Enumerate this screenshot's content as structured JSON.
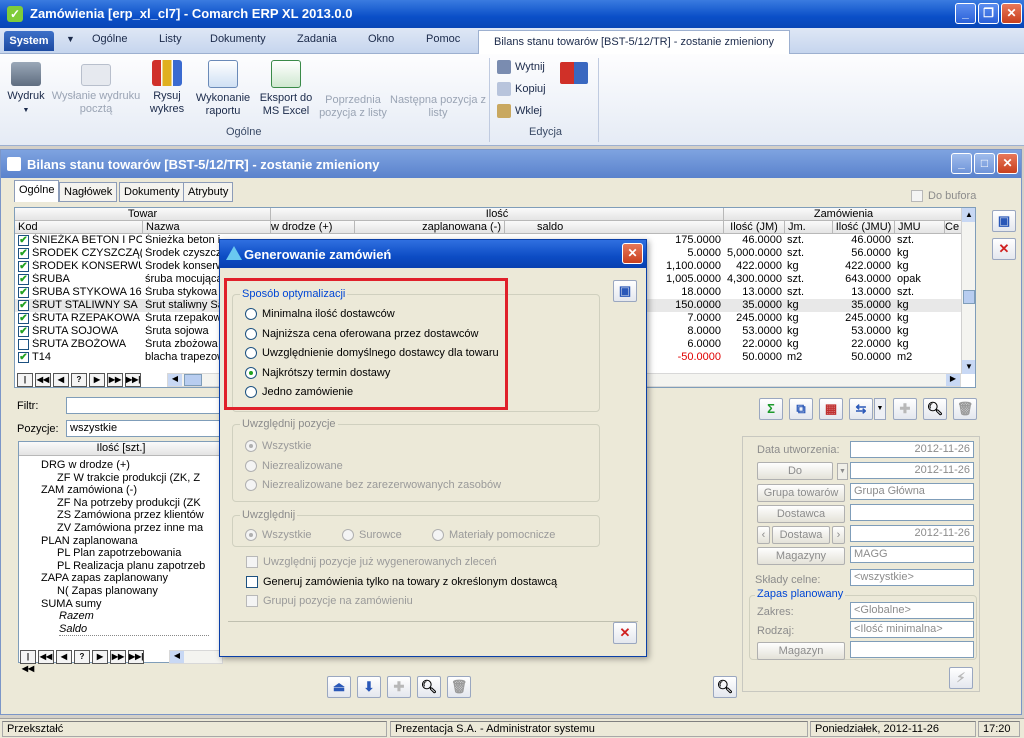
{
  "window": {
    "title": "Zamówienia [erp_xl_cl7] - Comarch ERP XL 2013.0.0"
  },
  "menu": {
    "system": "System",
    "items": [
      "Ogólne",
      "Listy",
      "Dokumenty",
      "Zadania",
      "Okno",
      "Pomoc"
    ],
    "active_tab": "Bilans stanu towarów [BST-5/12/TR] - zostanie zmieniony"
  },
  "ribbon": {
    "print": "Wydruk",
    "send_mail": "Wysłanie wydruku pocztą",
    "chart": "Rysuj wykres",
    "run_report": "Wykonanie raportu",
    "export_excel": "Eksport do MS Excel",
    "prev_item": "Poprzednia pozycja z listy",
    "next_item": "Następna pozycja z listy",
    "group_general": "Ogólne",
    "cut": "Wytnij",
    "copy": "Kopiuj",
    "paste": "Wklej",
    "group_edit": "Edycja"
  },
  "inner": {
    "title": "Bilans stanu towarów [BST-5/12/TR] - zostanie zmieniony",
    "tabs": [
      "Ogólne",
      "Nagłówek",
      "Dokumenty",
      "Atrybuty"
    ],
    "do_bufora": "Do bufora",
    "grid": {
      "group_towar": "Towar",
      "group_ilosc": "Ilość",
      "group_zamowienia": "Zamówienia",
      "col_kod": "Kod",
      "col_nazwa": "Nazwa",
      "col_w_drodze": "w drodze (+)",
      "col_zaplanowana": "zaplanowana (-)",
      "col_saldo": "saldo",
      "col_ilosc_jm": "Ilość (JM)",
      "col_jm": "Jm.",
      "col_ilosc_jmu": "Ilość (JMU)",
      "col_jmu": "JMU",
      "col_ce": "Ce",
      "rows": [
        {
          "kod": "ŚNIEŻKA BETON I PC",
          "nazwa": "Śnieżka beton i",
          "saldo": "175.0000",
          "ilosc_jm": "46.0000",
          "jm": "szt.",
          "ilosc_jmu": "46.0000",
          "jmu": "szt."
        },
        {
          "kod": "ŚRODEK CZYSZCZĄ(",
          "nazwa": "Środek czyszcz",
          "saldo": "5.0000",
          "ilosc_jm": "5,000.0000",
          "jm": "szt.",
          "ilosc_jmu": "56.0000",
          "jmu": "kg"
        },
        {
          "kod": "ŚRODEK KONSERWU",
          "nazwa": "Środek konserw",
          "saldo": "1,100.0000",
          "ilosc_jm": "422.0000",
          "jm": "kg",
          "ilosc_jmu": "422.0000",
          "jmu": "kg"
        },
        {
          "kod": "ŚRUBA",
          "nazwa": "śruba mocująca",
          "saldo": "1,005.0000",
          "ilosc_jm": "4,300.0000",
          "jm": "szt.",
          "ilosc_jmu": "643.0000",
          "jmu": "opak"
        },
        {
          "kod": "ŚRUBA STYKOWA 16",
          "nazwa": "Śruba stykowa",
          "saldo": "18.0000",
          "ilosc_jm": "13.0000",
          "jm": "szt.",
          "ilosc_jmu": "13.0000",
          "jmu": "szt."
        },
        {
          "kod": "ŚRUT STALIWNY SA",
          "nazwa": "Śrut staliwny Sa",
          "saldo": "150.0000",
          "ilosc_jm": "35.0000",
          "jm": "kg",
          "ilosc_jmu": "35.0000",
          "jmu": "kg"
        },
        {
          "kod": "ŚRUTA RZEPAKOWA",
          "nazwa": "Śruta rzepakow",
          "saldo": "7.0000",
          "ilosc_jm": "245.0000",
          "jm": "kg",
          "ilosc_jmu": "245.0000",
          "jmu": "kg"
        },
        {
          "kod": "ŚRUTA SOJOWA",
          "nazwa": "Śruta sojowa",
          "saldo": "8.0000",
          "ilosc_jm": "53.0000",
          "jm": "kg",
          "ilosc_jmu": "53.0000",
          "jmu": "kg"
        },
        {
          "kod": "ŚRUTA ZBOŻOWA",
          "nazwa": "Śruta zbożowa",
          "saldo": "6.0000",
          "ilosc_jm": "22.0000",
          "jm": "kg",
          "ilosc_jmu": "22.0000",
          "jmu": "kg"
        },
        {
          "kod": "T14",
          "nazwa": "blacha trapezow",
          "saldo": "-50.0000",
          "ilosc_jm": "50.0000",
          "jm": "m2",
          "ilosc_jmu": "50.0000",
          "jmu": "m2"
        }
      ]
    },
    "filter_label": "Filtr:",
    "positions_label": "Pozycje:",
    "positions_value": "wszystkie",
    "tree_header": "Ilość [szt.]",
    "tree": [
      {
        "code": "DRG",
        "label": "w drodze (+)"
      },
      {
        "code": "ZF",
        "label": "W trakcie produkcji (ZK, Z"
      },
      {
        "code": "ZAM",
        "label": "zamówiona (-)"
      },
      {
        "code": "ZF",
        "label": "Na potrzeby produkcji (ZK"
      },
      {
        "code": "ZS",
        "label": "Zamówiona przez klientów"
      },
      {
        "code": "ZV",
        "label": "Zamówiona przez inne ma"
      },
      {
        "code": "PLAN",
        "label": "zaplanowana"
      },
      {
        "code": "PL",
        "label": "Plan zapotrzebowania"
      },
      {
        "code": "PL",
        "label": "Realizacja planu zapotrzeb"
      },
      {
        "code": "ZAPA",
        "label": "zapas zaplanowany"
      },
      {
        "code": "N(",
        "label": "Zapas planowany"
      },
      {
        "code": "SUMA",
        "label": "sumy"
      },
      {
        "code": "",
        "label": "Razem"
      },
      {
        "code": "",
        "label": "Saldo"
      }
    ],
    "right": {
      "date_created_label": "Data utworzenia:",
      "date_created": "2012-11-26",
      "do_label": "Do",
      "do_date": "2012-11-26",
      "group_label": "Grupa towarów",
      "group_value": "Grupa Główna",
      "supplier_label": "Dostawca",
      "delivery_label": "Dostawa",
      "delivery_date": "2012-11-26",
      "warehouses_label": "Magazyny",
      "warehouses_value": "MAGG",
      "customs_label": "Składy celne:",
      "customs_value": "<wszystkie>",
      "planned_stock": "Zapas planowany",
      "zakres_label": "Zakres:",
      "zakres_value": "<Globalne>",
      "rodzaj_label": "Rodzaj:",
      "rodzaj_value": "<Ilość minimalna>",
      "warehouse_label": "Magazyn"
    }
  },
  "dialog": {
    "title": "Generowanie zamówień",
    "opt_group": "Sposób optymalizacji",
    "options": [
      "Minimalna ilość dostawców",
      "Najniższa cena oferowana przez dostawców",
      "Uwzględnienie domyślnego dostawcy dla towaru",
      "Najkrótszy termin dostawy",
      "Jedno zamówienie"
    ],
    "selected_option": 3,
    "positions_group": "Uwzględnij pozycje",
    "positions": [
      "Wszystkie",
      "Niezrealizowane",
      "Niezrealizowane bez zarezerwowanych zasobów"
    ],
    "include_group": "Uwzględnij",
    "include": [
      "Wszystkie",
      "Surowce",
      "Materiały pomocnicze"
    ],
    "chk_generated": "Uwzględnij pozycje już wygenerowanych zleceń",
    "chk_supplier": "Generuj zamówienia tylko na towary z określonym dostawcą",
    "chk_group": "Grupuj pozycje na zamówieniu"
  },
  "status": {
    "left": "Przekształć",
    "user": "Prezentacja S.A. - Administrator systemu",
    "date": "Poniedziałek, 2012-11-26",
    "time": "17:20"
  },
  "colors": {
    "titlebar": "#0a4fc8",
    "dialog_highlight": "#e0202a",
    "checkmark": "#21a121",
    "negative": "#e00000"
  }
}
